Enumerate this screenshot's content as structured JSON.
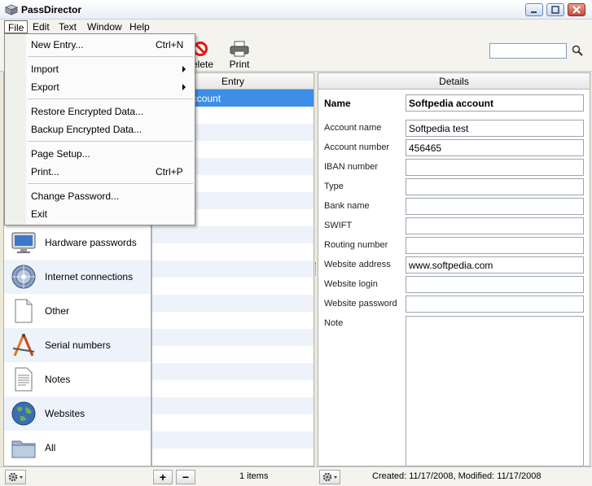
{
  "window": {
    "title": "PassDirector"
  },
  "menubar": {
    "file": "File",
    "edit": "Edit",
    "text": "Text",
    "window": "Window",
    "help": "Help"
  },
  "toolbar": {
    "delete_label": "elete",
    "print_label": "Print",
    "search_placeholder": ""
  },
  "file_menu": {
    "new_entry": "New Entry...",
    "new_entry_shortcut": "Ctrl+N",
    "import": "Import",
    "export": "Export",
    "restore": "Restore Encrypted Data...",
    "backup": "Backup Encrypted Data...",
    "page_setup": "Page Setup...",
    "print": "Print...",
    "print_shortcut": "Ctrl+P",
    "change_password": "Change Password...",
    "exit": "Exit"
  },
  "categories": [
    {
      "label": "Hardware passwords",
      "icon": "monitor-icon"
    },
    {
      "label": "Internet connections",
      "icon": "network-globe-icon"
    },
    {
      "label": "Other",
      "icon": "document-icon"
    },
    {
      "label": "Serial numbers",
      "icon": "compass-ruler-icon"
    },
    {
      "label": "Notes",
      "icon": "notes-icon"
    },
    {
      "label": "Websites",
      "icon": "globe-icon"
    },
    {
      "label": "All",
      "icon": "folder-icon"
    }
  ],
  "entries": {
    "header": "Entry",
    "selected": "tpedia account",
    "count": "1 items"
  },
  "details": {
    "header": "Details",
    "name_label": "Name",
    "name_value": "Softpedia account",
    "fields": [
      {
        "label": "Account name",
        "value": "Softpedia test"
      },
      {
        "label": "Account number",
        "value": "456465"
      },
      {
        "label": "IBAN number",
        "value": ""
      },
      {
        "label": "Type",
        "value": ""
      },
      {
        "label": "Bank name",
        "value": ""
      },
      {
        "label": "SWIFT",
        "value": ""
      },
      {
        "label": "Routing number",
        "value": ""
      },
      {
        "label": "Website address",
        "value": "www.softpedia.com"
      },
      {
        "label": "Website login",
        "value": ""
      },
      {
        "label": "Website password",
        "value": ""
      }
    ],
    "note_label": "Note",
    "status": "Created: 11/17/2008, Modified: 11/17/2008"
  },
  "bottom": {
    "add": "+",
    "remove": "−"
  },
  "colors": {
    "selection": "#3d8ee6",
    "alt_row": "#eef3fb"
  }
}
